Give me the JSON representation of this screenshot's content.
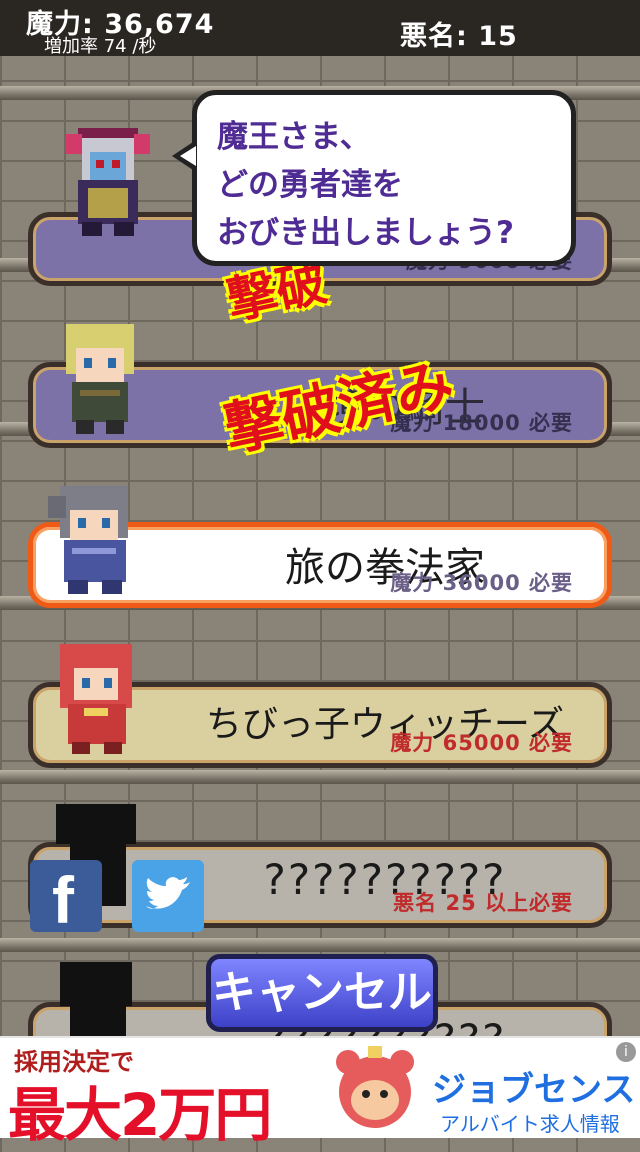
{
  "status": {
    "mana": "魔力: 36,674",
    "rate": "増加率 74 /秒",
    "infamy": "悪名: 15"
  },
  "dialog": {
    "lines": [
      "魔王さま、",
      "どの勇者達を",
      "おびき出しましょう?"
    ]
  },
  "heroes": [
    {
      "name": "",
      "requirement": "魔力 9000 必要",
      "state": "defeated"
    },
    {
      "name": "辺境の騎士",
      "requirement": "魔力 18000 必要",
      "state": "defeated"
    },
    {
      "name": "旅の拳法家",
      "requirement": "魔力 36000 必要",
      "state": "selected"
    },
    {
      "name": "ちびっ子ウィッチーズ",
      "requirement": "魔力 65000 必要",
      "state": "available"
    },
    {
      "name": "??????????",
      "requirement": "悪名 25 以上必要",
      "state": "locked"
    },
    {
      "name": "??????????",
      "requirement": "",
      "state": "locked"
    }
  ],
  "stamps": [
    "撃破",
    "撃破済み"
  ],
  "social": {
    "facebook": "f",
    "twitter": "twitter"
  },
  "cancel_label": "キャンセル",
  "ad": {
    "line1": "採用決定で",
    "line2": "最大2万円",
    "brand": "ジョブセンス",
    "sub": "アルバイト求人情報",
    "info": "i"
  },
  "colors": {
    "defeated": "#7d72a8",
    "selected_border": "#f05a17",
    "available": "#d9cf9f",
    "stamp": "#e10f1b",
    "dialog_text": "#4f2b94"
  }
}
